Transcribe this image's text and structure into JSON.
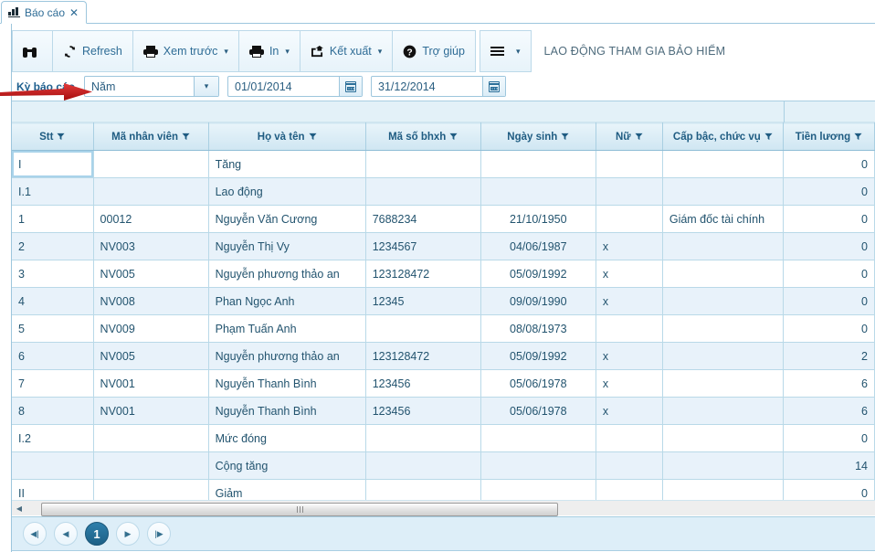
{
  "tab": {
    "label": "Báo cáo",
    "icon": "bar-chart-icon",
    "close": "✕"
  },
  "toolbar": {
    "find_label": "",
    "refresh_label": "Refresh",
    "preview_label": "Xem trước",
    "print_label": "In",
    "export_label": "Kết xuất",
    "help_label": "Trợ giúp",
    "menu_label": "",
    "caret": "▾",
    "report_title": "LAO ĐỘNG THAM GIA BẢO HIỂM"
  },
  "filterbar": {
    "period_label": "Kỳ báo cáo",
    "period_value": "Năm",
    "period_options": [
      "Năm"
    ],
    "date_from": "01/01/2014",
    "date_to": "31/12/2014",
    "caret": "▾"
  },
  "grid": {
    "columns": [
      {
        "label": "Stt",
        "align": "left"
      },
      {
        "label": "Mã nhân viên",
        "align": "left"
      },
      {
        "label": "Họ và tên",
        "align": "left"
      },
      {
        "label": "Mã số bhxh",
        "align": "left"
      },
      {
        "label": "Ngày sinh",
        "align": "center"
      },
      {
        "label": "Nữ",
        "align": "left"
      },
      {
        "label": "Cấp bậc, chức vụ",
        "align": "left"
      },
      {
        "label": "Tiền lương",
        "align": "right"
      }
    ],
    "rows": [
      {
        "cells": [
          "I",
          "",
          "Tăng",
          "",
          "",
          "",
          "",
          "0"
        ],
        "selected_cell": 0
      },
      {
        "cells": [
          "I.1",
          "",
          "Lao động",
          "",
          "",
          "",
          "",
          "0"
        ]
      },
      {
        "cells": [
          "1",
          "00012",
          "Nguyễn Văn Cương",
          "7688234",
          "21/10/1950",
          "",
          "Giám đốc tài chính",
          "0"
        ]
      },
      {
        "cells": [
          "2",
          "NV003",
          "Nguyễn Thị Vy",
          "1234567",
          "04/06/1987",
          "x",
          "",
          "0"
        ]
      },
      {
        "cells": [
          "3",
          "NV005",
          "Nguyễn phương thảo an",
          "123128472",
          "05/09/1992",
          "x",
          "",
          "0"
        ]
      },
      {
        "cells": [
          "4",
          "NV008",
          "Phan Ngọc Anh",
          "12345",
          "09/09/1990",
          "x",
          "",
          "0"
        ]
      },
      {
        "cells": [
          "5",
          "NV009",
          "Phạm Tuấn Anh",
          "",
          "08/08/1973",
          "",
          "",
          "0"
        ]
      },
      {
        "cells": [
          "6",
          "NV005",
          "Nguyễn phương thảo an",
          "123128472",
          "05/09/1992",
          "x",
          "",
          "2"
        ]
      },
      {
        "cells": [
          "7",
          "NV001",
          "Nguyễn Thanh Bình",
          "123456",
          "05/06/1978",
          "x",
          "",
          "6"
        ]
      },
      {
        "cells": [
          "8",
          "NV001",
          "Nguyễn Thanh Bình",
          "123456",
          "05/06/1978",
          "x",
          "",
          "6"
        ]
      },
      {
        "cells": [
          "I.2",
          "",
          "Mức đóng",
          "",
          "",
          "",
          "",
          "0"
        ]
      },
      {
        "cells": [
          "",
          "",
          "Cộng tăng",
          "",
          "",
          "",
          "",
          "14"
        ]
      },
      {
        "cells": [
          "II",
          "",
          "Giảm",
          "",
          "",
          "",
          "",
          "0"
        ]
      }
    ]
  },
  "pager": {
    "first": "◀|",
    "prev": "◀",
    "page": "1",
    "next": "▶",
    "last": "|▶"
  },
  "scrollbar": {
    "left_arrow": "◀",
    "right_arrow": "▶"
  },
  "colors": {
    "accent": "#2e7fab",
    "header_text": "#1f5c82",
    "grid_line": "#b9d9e8",
    "row_alt": "#e8f2fa",
    "annotation": "#d41515"
  }
}
